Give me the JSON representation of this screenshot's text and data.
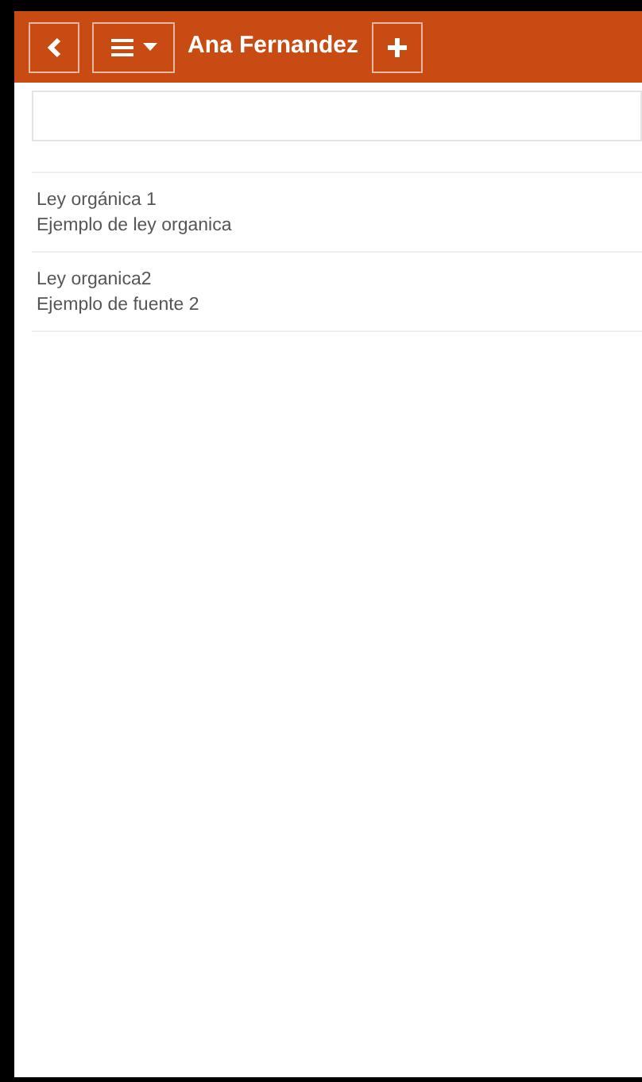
{
  "header": {
    "title": "Ana Fernandez"
  },
  "items": [
    {
      "title": "Ley orgánica 1",
      "subtitle": "Ejemplo de ley organica"
    },
    {
      "title": "Ley organica2",
      "subtitle": "Ejemplo de fuente 2"
    }
  ]
}
